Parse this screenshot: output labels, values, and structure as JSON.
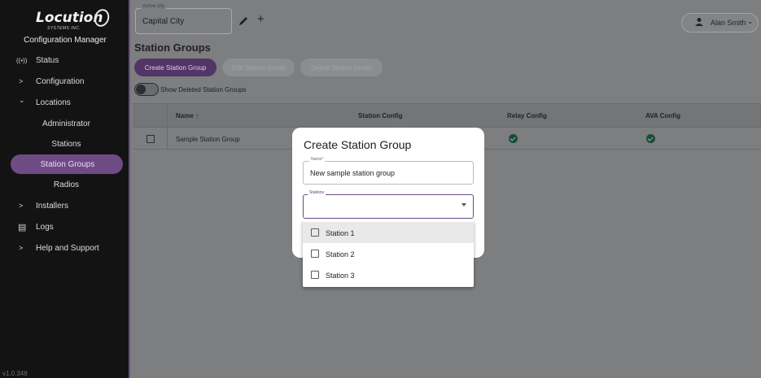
{
  "sidebar": {
    "logo_text": "Locution",
    "logo_sub": "SYSTEMS INC.",
    "title": "Configuration Manager",
    "items": [
      {
        "label": "Status",
        "glyph": "((•))"
      },
      {
        "label": "Configuration",
        "glyph": ">"
      },
      {
        "label": "Locations",
        "glyph": "⌄"
      },
      {
        "label": "Administrator"
      },
      {
        "label": "Stations"
      },
      {
        "label": "Station Groups"
      },
      {
        "label": "Radios"
      },
      {
        "label": "Installers",
        "glyph": ">"
      },
      {
        "label": "Logs",
        "glyph": "▤"
      },
      {
        "label": "Help and Support",
        "glyph": ">"
      }
    ],
    "version": "v1.0.348"
  },
  "topbar": {
    "city_legend": "Active city",
    "city_value": "Capital City",
    "user_name": "Alan Smith"
  },
  "main": {
    "title": "Station Groups",
    "buttons": {
      "create": "Create Station Group",
      "edit": "Edit Station Group",
      "delete": "Delete Station Group"
    },
    "toggle_label": "Show Deleted Station Groups",
    "columns": {
      "name": "Name ↑",
      "station_config": "Station Config",
      "relay_config": "Relay Config",
      "ava_config": "AVA Config"
    },
    "rows": [
      {
        "name": "Sample Station Group",
        "relay_ok": true,
        "ava_ok": true
      }
    ]
  },
  "dialog": {
    "title": "Create Station Group",
    "name_label": "Name*",
    "name_value": "New sample station group",
    "stations_label": "Stations",
    "options": [
      "Station 1",
      "Station 2",
      "Station 3"
    ],
    "hovered_option": "Station 1"
  },
  "colors": {
    "accent": "#6f4b86",
    "overlay": "#7d7e80",
    "sidebar_bg": "#131314"
  }
}
